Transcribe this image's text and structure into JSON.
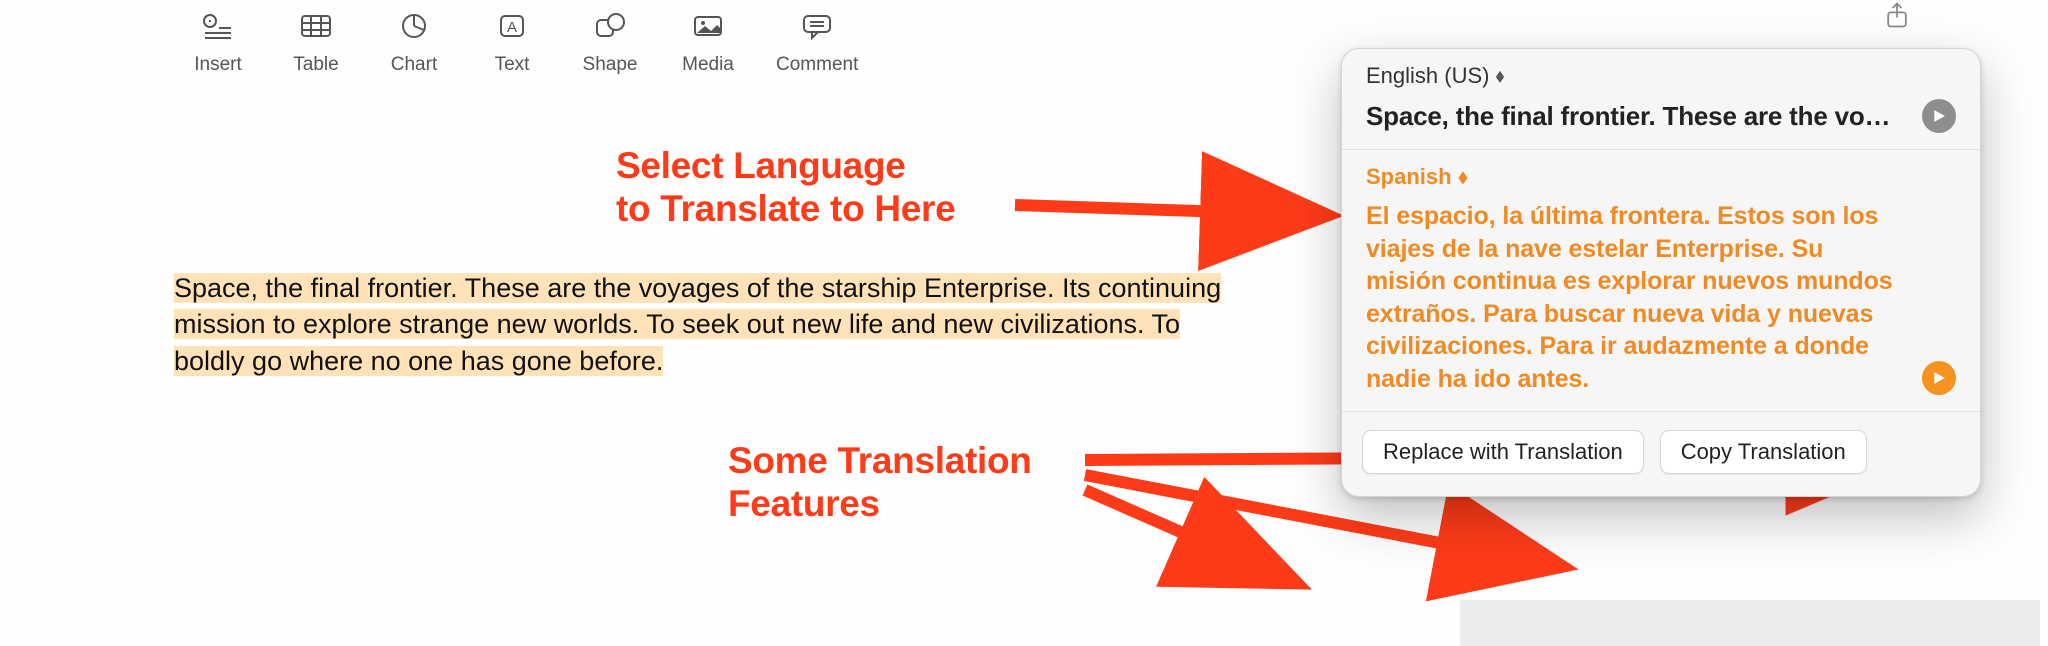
{
  "toolbar": {
    "insert": "Insert",
    "table": "Table",
    "chart": "Chart",
    "text": "Text",
    "shape": "Shape",
    "media": "Media",
    "comment": "Comment"
  },
  "document": {
    "highlighted_1": "Space, the final frontier. These are the voyages of the starship Enterprise. Its continuing",
    "highlighted_2": "mission to explore strange new worlds. To seek out new life and new civilizations. To",
    "highlighted_3": "boldly go where no one has gone before."
  },
  "annotations": {
    "select_language_line1": "Select Language",
    "select_language_line2": "to Translate to Here",
    "features_line1": "Some Translation",
    "features_line2": "Features"
  },
  "popover": {
    "source_lang": "English (US)",
    "source_text": "Space, the final frontier. These are the vo…",
    "target_lang": "Spanish",
    "target_text": "El espacio, la última frontera. Estos son los viajes de la nave estelar Enterprise. Su misión continua es explorar nuevos mundos extraños. Para buscar nueva vida y nuevas civilizaciones. Para ir audazmente a donde nadie ha ido antes.",
    "replace_btn": "Replace with Translation",
    "copy_btn": "Copy Translation"
  },
  "colors": {
    "annotation_red": "#fe3b19",
    "translation_orange": "#f08a24"
  }
}
